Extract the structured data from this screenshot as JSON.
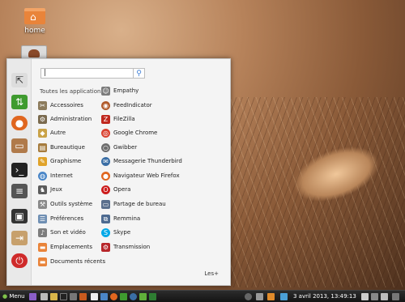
{
  "desktop": {
    "home_label": "home"
  },
  "search": {
    "value": "|"
  },
  "menu": {
    "all_apps_label": "Toutes les applications",
    "categories": [
      {
        "label": "Accessoires",
        "icon": "scissors-icon",
        "color": "#8c7b5c"
      },
      {
        "label": "Administration",
        "icon": "admin-icon",
        "color": "#7a6a4e"
      },
      {
        "label": "Autre",
        "icon": "other-icon",
        "color": "#c9a247"
      },
      {
        "label": "Bureautique",
        "icon": "office-icon",
        "color": "#a67c3e"
      },
      {
        "label": "Graphisme",
        "icon": "graphics-icon",
        "color": "#e0a32a"
      },
      {
        "label": "Internet",
        "icon": "globe-icon",
        "color": "#4a86c7"
      },
      {
        "label": "Jeux",
        "icon": "games-icon",
        "color": "#5c5c5c"
      },
      {
        "label": "Outils système",
        "icon": "system-tools-icon",
        "color": "#8a8a8a"
      },
      {
        "label": "Préférences",
        "icon": "preferences-icon",
        "color": "#6f8fb3"
      },
      {
        "label": "Son et vidéo",
        "icon": "multimedia-icon",
        "color": "#7d7d7d"
      },
      {
        "label": "Emplacements",
        "icon": "folder-icon",
        "color": "#e9843a"
      },
      {
        "label": "Documents récents",
        "icon": "folder-icon",
        "color": "#e9843a"
      }
    ],
    "apps": [
      {
        "label": "Empathy",
        "icon": "empathy-icon",
        "color": "#7b7b7b"
      },
      {
        "label": "FeedIndicator",
        "icon": "feed-icon",
        "color": "#b05a2a"
      },
      {
        "label": "FileZilla",
        "icon": "filezilla-icon",
        "color": "#c0281e"
      },
      {
        "label": "Google Chrome",
        "icon": "chrome-icon",
        "color": "#d9412f"
      },
      {
        "label": "Gwibber",
        "icon": "gwibber-icon",
        "color": "#6d6d6d"
      },
      {
        "label": "Messagerie Thunderbird",
        "icon": "thunderbird-icon",
        "color": "#3a6ea5"
      },
      {
        "label": "Navigateur Web Firefox",
        "icon": "firefox-icon",
        "color": "#e0661f"
      },
      {
        "label": "Opera",
        "icon": "opera-icon",
        "color": "#cc1b1b"
      },
      {
        "label": "Partage de bureau",
        "icon": "desktop-share-icon",
        "color": "#5a6f8c"
      },
      {
        "label": "Remmina",
        "icon": "remmina-icon",
        "color": "#4d6a90"
      },
      {
        "label": "Skype",
        "icon": "skype-icon",
        "color": "#00a8e8"
      },
      {
        "label": "Transmission",
        "icon": "transmission-icon",
        "color": "#b7262a"
      }
    ],
    "more_label": "Les+"
  },
  "taskbar": {
    "menu_label": "Menu",
    "clock": "3 avril 2013, 13:49:13"
  }
}
